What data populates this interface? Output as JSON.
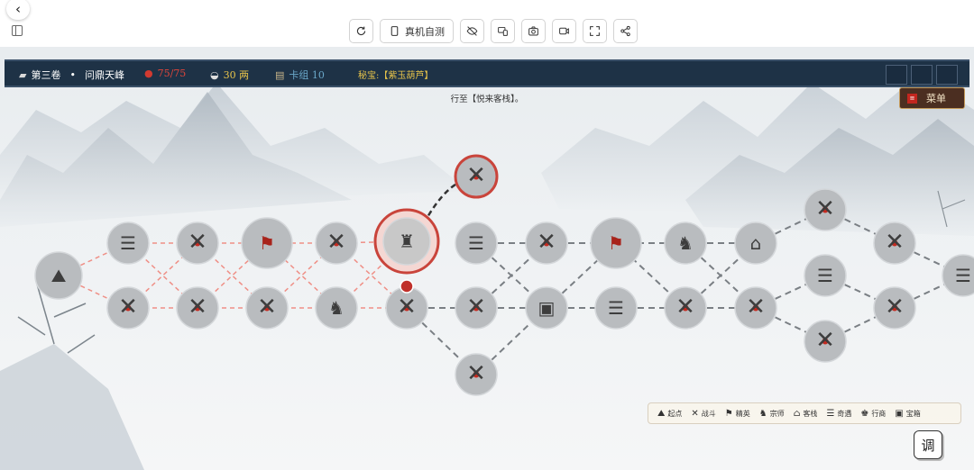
{
  "toolbar": {
    "back": "‹",
    "real_device_test": "真机自测",
    "buttons": [
      "refresh-icon",
      "phone-icon",
      "eye-off-icon",
      "screens-icon",
      "camera-icon",
      "video-icon",
      "fullscreen-icon",
      "share-icon"
    ]
  },
  "hud": {
    "volume": "第三卷",
    "separator": "•",
    "location": "问鼎天峰",
    "health": "75/75",
    "money": "30 两",
    "deck": "卡组 10",
    "treasure": "秘宝:【紫玉葫芦】",
    "colors": {
      "health": "#e0453a",
      "money": "#e8c44a",
      "deck": "#6aa7c9",
      "treasure": "#e8c44a"
    }
  },
  "menu_label": "菜单",
  "menu_icon_char": "≡",
  "status_text": "行至【悦来客栈】。",
  "legend": [
    {
      "icon": "start-icon",
      "glyph": "⛰",
      "label": "起点"
    },
    {
      "icon": "battle-icon",
      "glyph": "✕",
      "label": "战斗"
    },
    {
      "icon": "elite-icon",
      "glyph": "⚑",
      "label": "精英"
    },
    {
      "icon": "master-icon",
      "glyph": "♞",
      "label": "宗师"
    },
    {
      "icon": "inn-icon",
      "glyph": "⌂",
      "label": "客栈"
    },
    {
      "icon": "encounter-icon",
      "glyph": "☰",
      "label": "奇遇"
    },
    {
      "icon": "merchant-icon",
      "glyph": "♚",
      "label": "行商"
    },
    {
      "icon": "treasure-icon",
      "glyph": "▣",
      "label": "宝箱"
    }
  ],
  "tune_label": "调",
  "map_nodes": [
    {
      "type": "start"
    },
    {
      "type": "encounter"
    },
    {
      "type": "battle"
    },
    {
      "type": "battle"
    },
    {
      "type": "battle"
    },
    {
      "type": "elite"
    },
    {
      "type": "battle"
    },
    {
      "type": "battle"
    },
    {
      "type": "master"
    },
    {
      "type": "current"
    },
    {
      "type": "battle"
    },
    {
      "type": "battle",
      "state": "highlighted"
    },
    {
      "type": "encounter"
    },
    {
      "type": "battle"
    },
    {
      "type": "battle"
    },
    {
      "type": "battle"
    },
    {
      "type": "treasure"
    },
    {
      "type": "elite"
    },
    {
      "type": "encounter"
    },
    {
      "type": "master"
    },
    {
      "type": "battle"
    },
    {
      "type": "inn"
    },
    {
      "type": "battle"
    },
    {
      "type": "battle"
    },
    {
      "type": "encounter"
    },
    {
      "type": "battle"
    },
    {
      "type": "battle"
    },
    {
      "type": "battle"
    },
    {
      "type": "encounter"
    }
  ]
}
